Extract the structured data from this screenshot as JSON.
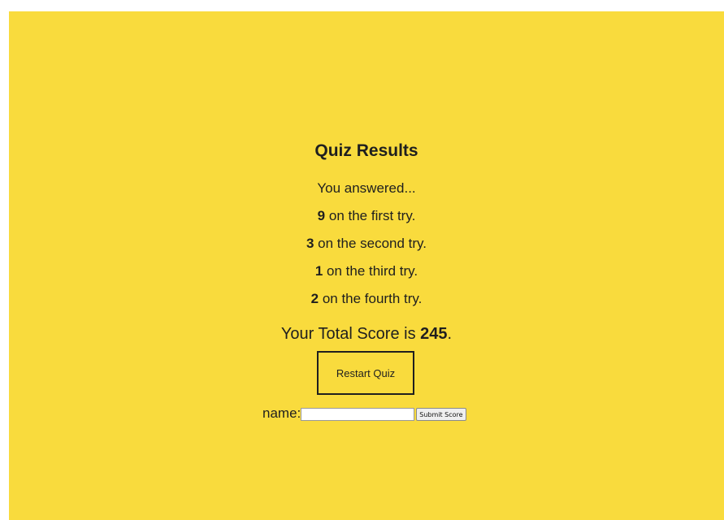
{
  "quiz": {
    "title": "Quiz Results",
    "intro": "You answered...",
    "tries": [
      {
        "count": "9",
        "text": " on the first try."
      },
      {
        "count": "3",
        "text": " on the second try."
      },
      {
        "count": "1",
        "text": " on the third try."
      },
      {
        "count": "2",
        "text": " on the fourth try."
      }
    ],
    "total_prefix": "Your Total Score is ",
    "total_score": "245",
    "total_suffix": "."
  },
  "controls": {
    "restart_label": "Restart Quiz",
    "name_label": "name:",
    "name_value": "",
    "submit_label": "Submit Score"
  },
  "colors": {
    "background": "#f9db3d",
    "text": "#1f1f1f"
  }
}
